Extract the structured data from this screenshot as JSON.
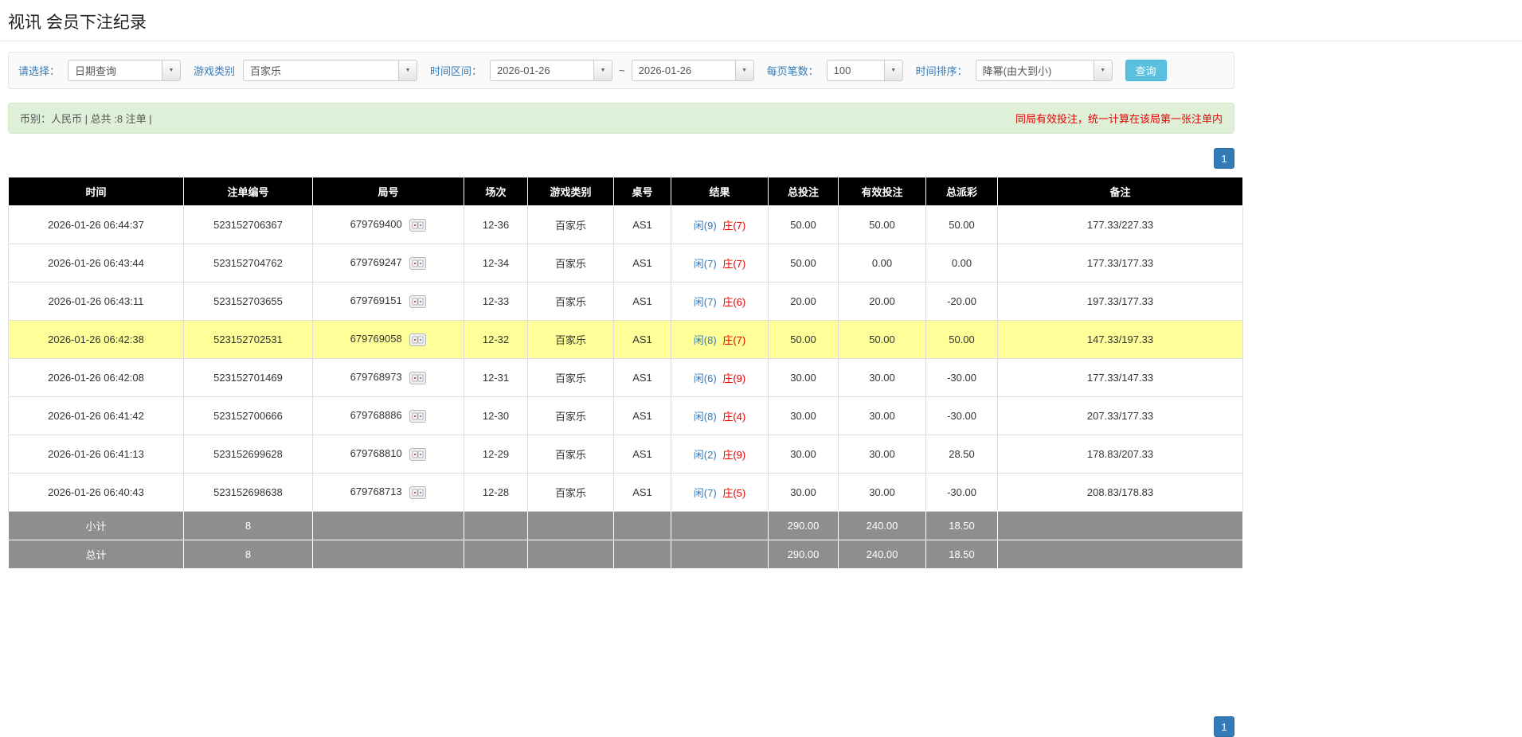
{
  "page": {
    "title": "视讯 会员下注纪录"
  },
  "icons": {
    "caret": "▼"
  },
  "filters": {
    "select_label": "请选择：",
    "select_value": "日期查询",
    "game_type_label": "游戏类别",
    "game_type_value": "百家乐",
    "time_range_label": "时间区间：",
    "date_from": "2026-01-26",
    "date_separator": "~",
    "date_to": "2026-01-26",
    "page_size_label": "每页笔数：",
    "page_size_value": "100",
    "sort_label": "时间排序：",
    "sort_value": "降幂(由大到小)",
    "search_button": "查询"
  },
  "summary": {
    "left": "币别：人民币 | 总共 :8 注单 |",
    "right": "同局有效投注，统一计算在该局第一张注单内"
  },
  "pagination": {
    "page": "1"
  },
  "table": {
    "headers": [
      "时间",
      "注单编号",
      "局号",
      "场次",
      "游戏类别",
      "桌号",
      "结果",
      "总投注",
      "有效投注",
      "总派彩",
      "备注"
    ],
    "rows": [
      {
        "time": "2026-01-26 06:44:37",
        "bet_id": "523152706367",
        "round_id": "679769400",
        "session": "12-36",
        "game": "百家乐",
        "table_no": "AS1",
        "result_player": "闲(9)",
        "result_banker": "庄(7)",
        "total_bet": "50.00",
        "valid_bet": "50.00",
        "payout": "50.00",
        "remark": "177.33/227.33",
        "highlight": false
      },
      {
        "time": "2026-01-26 06:43:44",
        "bet_id": "523152704762",
        "round_id": "679769247",
        "session": "12-34",
        "game": "百家乐",
        "table_no": "AS1",
        "result_player": "闲(7)",
        "result_banker": "庄(7)",
        "total_bet": "50.00",
        "valid_bet": "0.00",
        "payout": "0.00",
        "remark": "177.33/177.33",
        "highlight": false
      },
      {
        "time": "2026-01-26 06:43:11",
        "bet_id": "523152703655",
        "round_id": "679769151",
        "session": "12-33",
        "game": "百家乐",
        "table_no": "AS1",
        "result_player": "闲(7)",
        "result_banker": "庄(6)",
        "total_bet": "20.00",
        "valid_bet": "20.00",
        "payout": "-20.00",
        "remark": "197.33/177.33",
        "highlight": false
      },
      {
        "time": "2026-01-26 06:42:38",
        "bet_id": "523152702531",
        "round_id": "679769058",
        "session": "12-32",
        "game": "百家乐",
        "table_no": "AS1",
        "result_player": "闲(8)",
        "result_banker": "庄(7)",
        "total_bet": "50.00",
        "valid_bet": "50.00",
        "payout": "50.00",
        "remark": "147.33/197.33",
        "highlight": true
      },
      {
        "time": "2026-01-26 06:42:08",
        "bet_id": "523152701469",
        "round_id": "679768973",
        "session": "12-31",
        "game": "百家乐",
        "table_no": "AS1",
        "result_player": "闲(6)",
        "result_banker": "庄(9)",
        "total_bet": "30.00",
        "valid_bet": "30.00",
        "payout": "-30.00",
        "remark": "177.33/147.33",
        "highlight": false
      },
      {
        "time": "2026-01-26 06:41:42",
        "bet_id": "523152700666",
        "round_id": "679768886",
        "session": "12-30",
        "game": "百家乐",
        "table_no": "AS1",
        "result_player": "闲(8)",
        "result_banker": "庄(4)",
        "total_bet": "30.00",
        "valid_bet": "30.00",
        "payout": "-30.00",
        "remark": "207.33/177.33",
        "highlight": false
      },
      {
        "time": "2026-01-26 06:41:13",
        "bet_id": "523152699628",
        "round_id": "679768810",
        "session": "12-29",
        "game": "百家乐",
        "table_no": "AS1",
        "result_player": "闲(2)",
        "result_banker": "庄(9)",
        "total_bet": "30.00",
        "valid_bet": "30.00",
        "payout": "28.50",
        "remark": "178.83/207.33",
        "highlight": false
      },
      {
        "time": "2026-01-26 06:40:43",
        "bet_id": "523152698638",
        "round_id": "679768713",
        "session": "12-28",
        "game": "百家乐",
        "table_no": "AS1",
        "result_player": "闲(7)",
        "result_banker": "庄(5)",
        "total_bet": "30.00",
        "valid_bet": "30.00",
        "payout": "-30.00",
        "remark": "208.83/178.83",
        "highlight": false
      }
    ],
    "subtotal": {
      "label": "小计",
      "count": "8",
      "total_bet": "290.00",
      "valid_bet": "240.00",
      "payout": "18.50"
    },
    "total": {
      "label": "总计",
      "count": "8",
      "total_bet": "290.00",
      "valid_bet": "240.00",
      "payout": "18.50"
    }
  }
}
